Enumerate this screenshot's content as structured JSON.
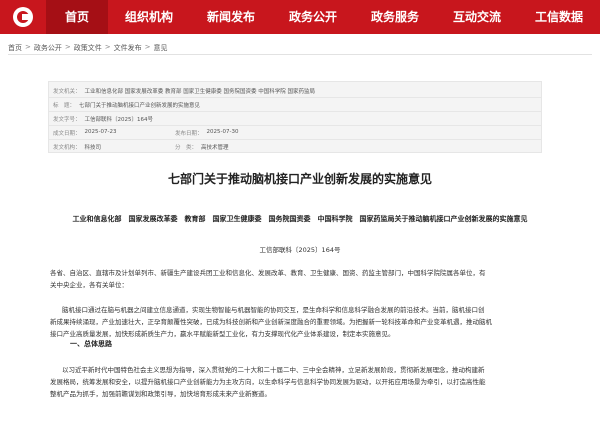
{
  "nav": {
    "items": [
      {
        "label": "首页",
        "active": true
      },
      {
        "label": "组织机构"
      },
      {
        "label": "新闻发布"
      },
      {
        "label": "政务公开"
      },
      {
        "label": "政务服务"
      },
      {
        "label": "互动交流"
      },
      {
        "label": "工信数据"
      }
    ],
    "brand_color": "#c8161d"
  },
  "breadcrumb": [
    "首页",
    "政务公开",
    "政策文件",
    "文件发布",
    "意见"
  ],
  "info": {
    "issuer_key": "发文机关：",
    "issuer_val": "工业和信息化部 国家发展改革委 教育部 国家卫生健康委 国务院国资委 中国科学院 国家药监局",
    "title_key": "标　题：",
    "title_val": "七部门关于推动脑机接口产业创新发展的实施意见",
    "docno_key": "发文字号：",
    "docno_val": "工信部联科〔2025〕164号",
    "date_key": "成文日期：",
    "date_val": "2025-07-23",
    "pub_key": "发布日期：",
    "pub_val": "2025-07-30",
    "org_key": "发文机构：",
    "org_val": "科技司",
    "cat_key": "分　类：",
    "cat_val": "高技术管理"
  },
  "article": {
    "title": "七部门关于推动脑机接口产业创新发展的实施意见",
    "subhead": "工业和信息化部　国家发展改革委　教育部　国家卫生健康委　国务院国资委　中国科学院　国家药监局关于推动脑机接口产业创新发展的实施意见",
    "docno": "工信部联科〔2025〕164号",
    "para1": [
      "各省、自治区、直辖市及计划单列市、新疆生产建设兵团工业和信息化、发展改革、教育、卫生健康、国资、药监主管部门，中国科学院院属各单位，有",
      "关中央企业，各有关单位："
    ],
    "para2": [
      "脑机接口通过在脑与机器之间建立信息通道，实现生物智能与机器智能的协同交互，是生命科学和信息科学融合发展的前沿技术。当前，脑机接口创",
      "新成果持续涌现，产业加速壮大，正孕育颠覆性突破，已成为科技创新和产业创新深度融合的重要领域。为把握新一轮科技革命和产业变革机遇，推动脑机",
      "接口产业高质量发展，加快形成新质生产力，赢水平赋能新型工业化，有力支撑现代化产业体系建设，制定本实施意见。"
    ],
    "section1": "一、总体思路",
    "para3": [
      "以习近平新时代中国特色社会主义思想为指导，深入贯彻党的二十大和二十届二中、三中全会精神，立足新发展阶段，贯彻新发展理念，推动构建新",
      "发展格局，统筹发展和安全，以提升脑机接口产业创新能力为主攻方向，以生命科学与信息科学协同发展为驱动，以开拓应用场景为牵引，以打造高性能",
      "整机产品为抓手，加强前瞻谋划和政策引导，加快培育形成未来产业新赛道。"
    ]
  }
}
